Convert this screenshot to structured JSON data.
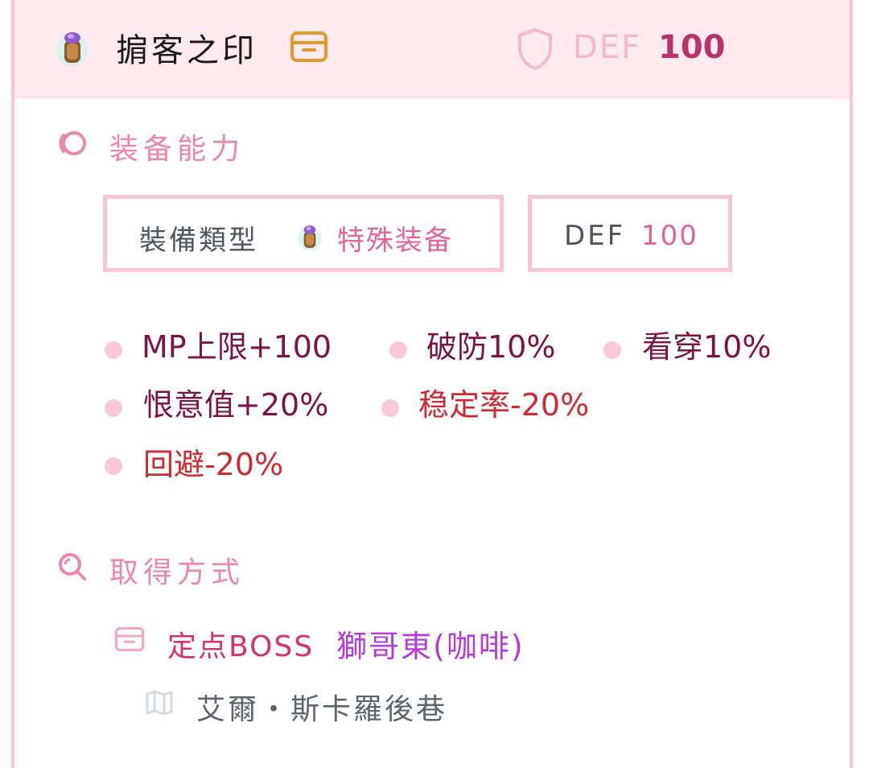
{
  "item": {
    "name": "掮客之印",
    "icon": "ring-gem-icon",
    "def_label": "DEF",
    "def_value": "100"
  },
  "ability": {
    "title": "装备能力",
    "type_label": "裝備類型",
    "type_value": "特殊装备",
    "def_label": "DEF",
    "def_value": "100",
    "stats": [
      {
        "text": "MP上限+100",
        "negative": false
      },
      {
        "text": "破防10%",
        "negative": false
      },
      {
        "text": "看穿10%",
        "negative": false
      },
      {
        "text": "恨意值+20%",
        "negative": false
      },
      {
        "text": "稳定率-20%",
        "negative": true
      },
      {
        "text": "回避-20%",
        "negative": true
      }
    ]
  },
  "acquire": {
    "title": "取得方式",
    "source_type": "定点BOSS",
    "source_name": "獅哥東(咖啡)",
    "location": "艾爾・斯卡羅後巷"
  },
  "colors": {
    "accent_pink": "#ee86ac",
    "positive_stat": "#7a1447",
    "negative_stat": "#cf2a33",
    "boss_name": "#b43bd6"
  }
}
